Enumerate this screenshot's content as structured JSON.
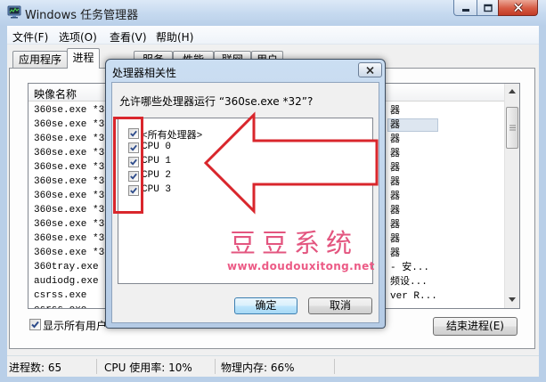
{
  "window": {
    "title": "Windows 任务管理器"
  },
  "menu": [
    "文件(F)",
    "选项(O)",
    "查看(V)",
    "帮助(H)"
  ],
  "tabs": [
    "应用程序",
    "进程",
    "服务",
    "性能",
    "联网",
    "用户"
  ],
  "selected_tab_index": 1,
  "process_list": {
    "column_header": "映像名称",
    "selected_row": 1,
    "rows": [
      {
        "name": "360se.exe *32",
        "description": "器"
      },
      {
        "name": "360se.exe *32",
        "description": "器"
      },
      {
        "name": "360se.exe *32",
        "description": "器"
      },
      {
        "name": "360se.exe *32",
        "description": "器"
      },
      {
        "name": "360se.exe *32",
        "description": "器"
      },
      {
        "name": "360se.exe *32",
        "description": "器"
      },
      {
        "name": "360se.exe *32",
        "description": "器"
      },
      {
        "name": "360se.exe *32",
        "description": "器"
      },
      {
        "name": "360se.exe *32",
        "description": "器"
      },
      {
        "name": "360se.exe *32",
        "description": "器"
      },
      {
        "name": "360se.exe *32",
        "description": "器"
      },
      {
        "name": "360tray.exe *",
        "description": "- 安..."
      },
      {
        "name": "audiodg.exe",
        "description": "频设..."
      },
      {
        "name": "csrss.exe",
        "description": "ver R..."
      },
      {
        "name": "csrss.exe",
        "description": ""
      }
    ]
  },
  "show_all_users": {
    "label": "显示所有用户",
    "checked": true
  },
  "end_process_button": "结束进程(E)",
  "status_bar": {
    "processes": "进程数: 65",
    "cpu": "CPU 使用率: 10%",
    "memory": "物理内存: 66%"
  },
  "dialog": {
    "title": "处理器相关性",
    "prompt": "允许哪些处理器运行 “360se.exe *32”?",
    "processors": [
      {
        "label": "<所有处理器>",
        "checked": true
      },
      {
        "label": "CPU 0",
        "checked": true
      },
      {
        "label": "CPU 1",
        "checked": true
      },
      {
        "label": "CPU 2",
        "checked": true
      },
      {
        "label": "CPU 3",
        "checked": true
      }
    ],
    "ok": "确定",
    "cancel": "取消"
  },
  "watermark": {
    "title": "豆豆系统",
    "url": "www.doudouxitong.net"
  },
  "icons": [
    "task-manager-icon",
    "minimize-icon",
    "maximize-icon",
    "close-icon",
    "checkbox-check-icon",
    "scroll-up-icon",
    "scroll-down-icon",
    "annotation-arrow",
    "annotation-box"
  ],
  "colors": {
    "annotation_red": "#d9262c",
    "watermark_pink": "#e3557f",
    "close_button_red": "#c23c26",
    "default_button_border": "#3c7fb1",
    "checkmark": "#2c4a8a"
  }
}
